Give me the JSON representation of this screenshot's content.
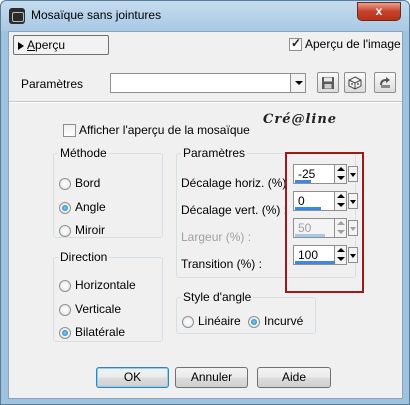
{
  "window": {
    "title": "Mosaïque sans jointures",
    "close_glyph": "x"
  },
  "toolbar": {
    "preview_label_pre": "",
    "preview_label_u": "A",
    "preview_label_post": "perçu",
    "apercu_image_label": "Aperçu de l'image",
    "apercu_image_checked": true
  },
  "params_row": {
    "label": "Paramètres",
    "combo_value": ""
  },
  "show_preview": {
    "label": "Afficher l'aperçu de la mosaïque",
    "checked": false
  },
  "logo": {
    "text": "Cré@line"
  },
  "methode": {
    "legend": "Méthode",
    "options": [
      "Bord",
      "Angle",
      "Miroir"
    ],
    "selected": "Angle"
  },
  "direction": {
    "legend": "Direction",
    "options": [
      "Horizontale",
      "Verticale",
      "Bilatérale"
    ],
    "selected": "Bilatérale"
  },
  "parametres": {
    "legend": "Paramètres",
    "fields": [
      {
        "label": "Décalage horiz. (%)",
        "value": "-25",
        "enabled": true,
        "fill_fraction": 0.4
      },
      {
        "label": "Décalage vert. (%) :",
        "value": "0",
        "enabled": true,
        "fill_fraction": 0.65
      },
      {
        "label": "Largeur (%) :",
        "value": "50",
        "enabled": false,
        "fill_fraction": 0.75
      },
      {
        "label": "Transition (%) :",
        "value": "100",
        "enabled": true,
        "fill_fraction": 1.0
      }
    ]
  },
  "style_angle": {
    "legend": "Style d'angle",
    "options": [
      "Linéaire",
      "Incurvé"
    ],
    "selected": "Incurvé"
  },
  "buttons": {
    "ok": "OK",
    "annuler": "Annuler",
    "aide": "Aide"
  },
  "colors": {
    "accent_blue": "#3c8ae0",
    "highlight_red": "#9b1b1b",
    "window_frame": "#9fc3de"
  }
}
